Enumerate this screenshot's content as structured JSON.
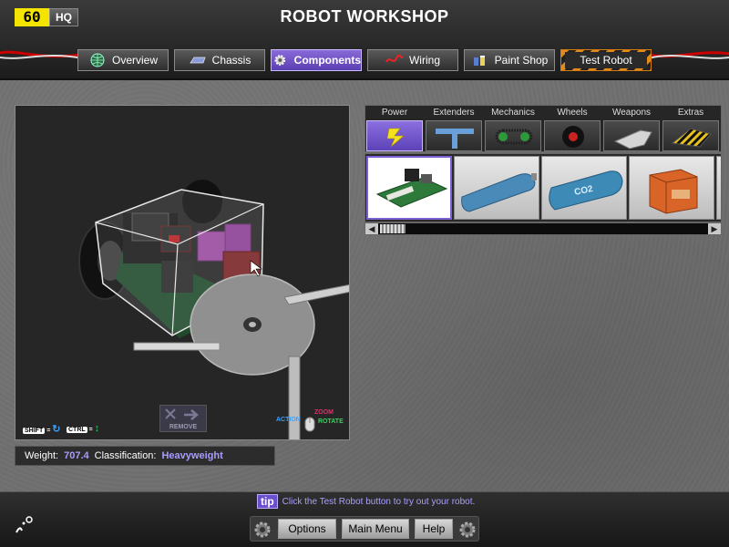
{
  "header": {
    "fps_badge": "60",
    "hq_label": "HQ",
    "title": "ROBOT WORKSHOP",
    "tabs": [
      {
        "label": "Overview",
        "icon": "globe-icon",
        "active": false
      },
      {
        "label": "Chassis",
        "icon": "chassis-icon",
        "active": false
      },
      {
        "label": "Components",
        "icon": "gear-icon",
        "active": true
      },
      {
        "label": "Wiring",
        "icon": "wire-icon",
        "active": false
      },
      {
        "label": "Paint Shop",
        "icon": "paint-cans-icon",
        "active": false
      },
      {
        "label": "Test Robot",
        "icon": "",
        "active": false
      }
    ]
  },
  "viewport": {
    "shift_key": "SHIFT",
    "ctrl_key": "CTRL",
    "action_label": "ACTION",
    "zoom_label": "ZOOM",
    "rotate_label": "ROTATE",
    "remove_label": "REMOVE"
  },
  "info": {
    "weight_label": "Weight:",
    "weight_value": "707.4",
    "class_label": "Classification:",
    "class_value": "Heavyweight"
  },
  "categories": [
    {
      "label": "Power",
      "icon": "lightning-icon",
      "active": true
    },
    {
      "label": "Extenders",
      "icon": "t-bar-icon",
      "active": false
    },
    {
      "label": "Mechanics",
      "icon": "chain-drive-icon",
      "active": false
    },
    {
      "label": "Wheels",
      "icon": "wheel-icon",
      "active": false
    },
    {
      "label": "Weapons",
      "icon": "blade-icon",
      "active": false
    },
    {
      "label": "Extras",
      "icon": "hazard-plate-icon",
      "active": false
    }
  ],
  "parts": [
    {
      "name": "circuit-board-part",
      "label": ""
    },
    {
      "name": "tank-part",
      "label": ""
    },
    {
      "name": "co2-tank-part",
      "label": "CO2"
    },
    {
      "name": "battery-box-part",
      "label": ""
    }
  ],
  "footer": {
    "tip_tag": "tip",
    "tip_text": "Click the Test Robot button to try out your robot.",
    "buttons": [
      "Options",
      "Main Menu",
      "Help"
    ]
  },
  "colors": {
    "accent": "#6a4fd0",
    "accent_text": "#a99cff",
    "warning_stripe": "#e38a1c"
  }
}
